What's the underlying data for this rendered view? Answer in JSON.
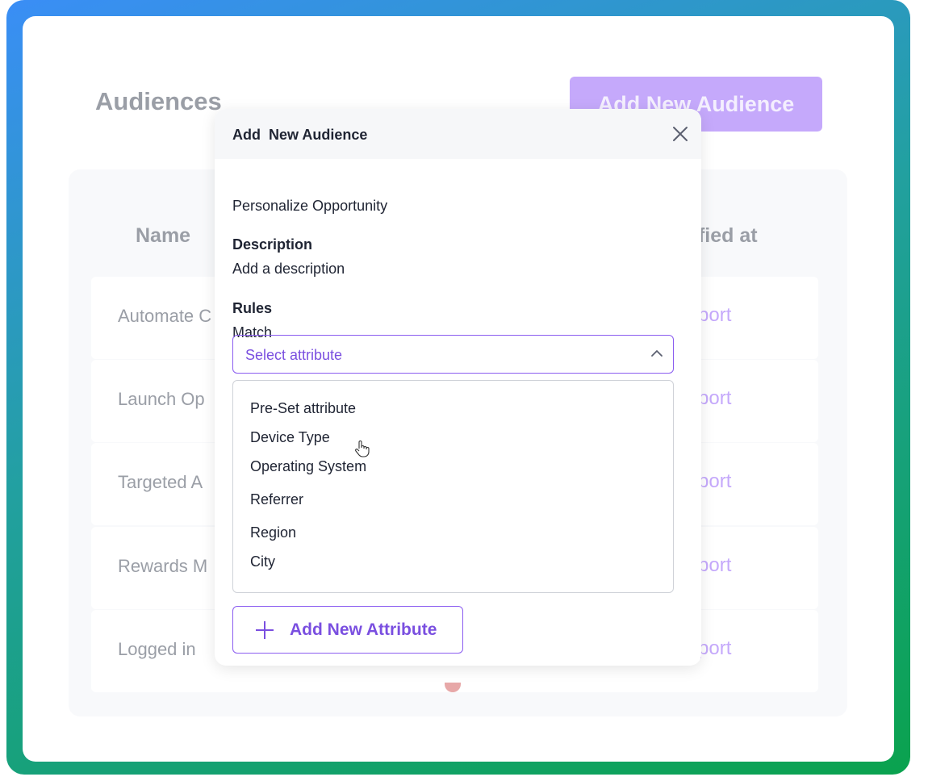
{
  "page": {
    "title": "Audiences",
    "add_button_label": "Add New Audience"
  },
  "table": {
    "columns": [
      "Name",
      "ified at"
    ],
    "rows": [
      {
        "name": "Automate C",
        "action": "port"
      },
      {
        "name": "Launch Op",
        "action": "port"
      },
      {
        "name": "Targeted A",
        "action": "port"
      },
      {
        "name": "Rewards M",
        "action": "port"
      },
      {
        "name": "Logged in",
        "action": "port"
      }
    ]
  },
  "modal": {
    "title": "Add  New Audience",
    "name_value": "Personalize Opportunity",
    "description_label": "Description",
    "description_placeholder": "Add a description",
    "rules_label": "Rules",
    "match_label": "Match",
    "select_placeholder": "Select attribute",
    "options": [
      "Pre-Set attribute",
      "Device Type",
      "Operating System",
      "Referrer",
      "Region",
      "City"
    ],
    "add_attribute_label": "Add New Attribute"
  },
  "colors": {
    "accent": "#7a4fe0",
    "accent_light": "#c5a9fb",
    "frame_gradient_start": "#3a8ef6",
    "frame_gradient_end": "#0aa24e"
  },
  "icons": {
    "close": "close-icon",
    "chevron": "chevron-up-icon",
    "plus": "plus-icon",
    "cursor": "hand-cursor-icon"
  }
}
